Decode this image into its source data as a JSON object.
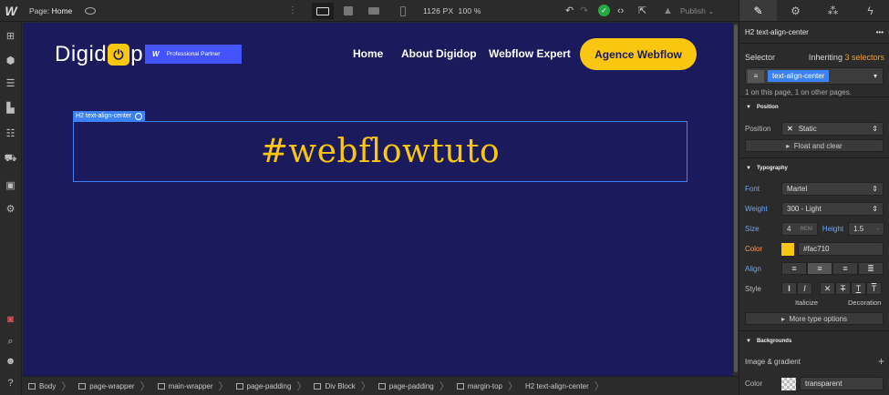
{
  "topbar": {
    "logo": "W",
    "page_prefix": "Page:",
    "page_name": "Home",
    "width_readout": "1126 PX",
    "zoom_readout": "100 %",
    "publish_label": "Publish"
  },
  "canvas": {
    "brand_text_left": "Digid",
    "brand_text_right": "p",
    "partner_logo": "W",
    "partner_label": "Professional Partner",
    "nav": [
      "Home",
      "About Digidop",
      "Webflow Expert"
    ],
    "cta_label": "Agence Webflow",
    "selected_tag": "H2 text-align-center",
    "heading": "#webflowtuto"
  },
  "breadcrumbs": [
    "Body",
    "page-wrapper",
    "main-wrapper",
    "page-padding",
    "Div Block",
    "page-padding",
    "margin-top",
    "H2 text-align-center"
  ],
  "panel": {
    "element_title": "H2 text-align-center",
    "selector_label": "Selector",
    "inheriting_prefix": "Inheriting",
    "inheriting_count": "3 selectors",
    "class_chip": "text-align-center",
    "usage_note": "1 on this page, 1 on other pages.",
    "position_section": "Position",
    "position_label": "Position",
    "position_value": "Static",
    "float_clear": "Float and clear",
    "typography_section": "Typography",
    "font_label": "Font",
    "font_value": "Martel",
    "weight_label": "Weight",
    "weight_value": "300 - Light",
    "size_label": "Size",
    "size_value": "4",
    "size_unit": "REM",
    "height_label": "Height",
    "height_value": "1.5",
    "height_dash": "-",
    "color_label": "Color",
    "color_value": "#fac710",
    "align_label": "Align",
    "style_label": "Style",
    "italicize_label": "Italicize",
    "decoration_label": "Decoration",
    "more_type": "More type options",
    "backgrounds_section": "Backgrounds",
    "image_gradient": "Image & gradient",
    "bg_color_label": "Color",
    "bg_color_value": "transparent"
  },
  "colors": {
    "canvas_bg": "#1b1a5c",
    "accent_yellow": "#fac710",
    "partner_blue": "#4353ff",
    "selection_blue": "#3b82f6"
  }
}
